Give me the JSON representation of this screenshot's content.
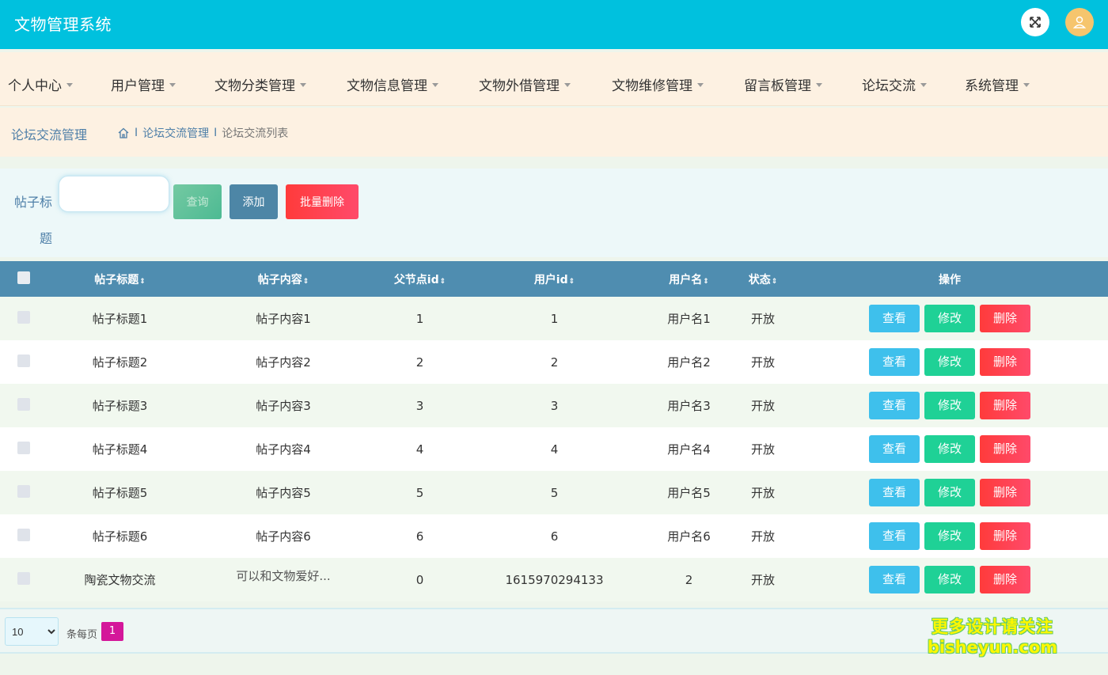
{
  "header": {
    "title": "文物管理系统",
    "fullscreen_icon": "fullscreen-icon",
    "avatar_icon": "user-icon"
  },
  "menu": [
    {
      "label": "个人中心"
    },
    {
      "label": "用户管理"
    },
    {
      "label": "文物分类管理"
    },
    {
      "label": "文物信息管理"
    },
    {
      "label": "文物外借管理"
    },
    {
      "label": "文物维修管理"
    },
    {
      "label": "留言板管理"
    },
    {
      "label": "论坛交流"
    },
    {
      "label": "系统管理"
    }
  ],
  "breadcrumb": {
    "section_title": "论坛交流管理",
    "home_icon": "home-icon",
    "items": [
      "论坛交流管理",
      "论坛交流列表"
    ]
  },
  "search": {
    "label": "帖子标题",
    "input_value": "",
    "search_button": "查询",
    "add_button": "添加",
    "batch_delete_button": "批量删除"
  },
  "table": {
    "columns": [
      "帖子标题",
      "帖子内容",
      "父节点id",
      "用户id",
      "用户名",
      "状态",
      "操作"
    ],
    "sort_icon": "⇕",
    "rows": [
      {
        "title": "帖子标题1",
        "content": "帖子内容1",
        "parent_id": "1",
        "user_id": "1",
        "username": "用户名1",
        "status": "开放"
      },
      {
        "title": "帖子标题2",
        "content": "帖子内容2",
        "parent_id": "2",
        "user_id": "2",
        "username": "用户名2",
        "status": "开放"
      },
      {
        "title": "帖子标题3",
        "content": "帖子内容3",
        "parent_id": "3",
        "user_id": "3",
        "username": "用户名3",
        "status": "开放"
      },
      {
        "title": "帖子标题4",
        "content": "帖子内容4",
        "parent_id": "4",
        "user_id": "4",
        "username": "用户名4",
        "status": "开放"
      },
      {
        "title": "帖子标题5",
        "content": "帖子内容5",
        "parent_id": "5",
        "user_id": "5",
        "username": "用户名5",
        "status": "开放"
      },
      {
        "title": "帖子标题6",
        "content": "帖子内容6",
        "parent_id": "6",
        "user_id": "6",
        "username": "用户名6",
        "status": "开放"
      },
      {
        "title": "陶瓷文物交流",
        "content": "可以和文物爱好...",
        "parent_id": "0",
        "user_id": "1615970294133",
        "username": "2",
        "status": "开放"
      }
    ],
    "actions": {
      "view": "查看",
      "edit": "修改",
      "delete": "删除"
    }
  },
  "pagination": {
    "page_size": "10",
    "page_size_options": [
      "10"
    ],
    "per_page_label": "条每页",
    "current_page": "1"
  },
  "watermark": {
    "line1": "更多设计请关注",
    "line2": "bisheyun.com"
  },
  "colors": {
    "header_bg": "#00c1de",
    "menu_bg": "#fdf1e2",
    "table_header_bg": "#4f8db0",
    "view_btn": "#3ec0ec",
    "edit_btn": "#1fd196",
    "delete_btn": "#ff3b3b",
    "page_active": "#d4179a"
  }
}
